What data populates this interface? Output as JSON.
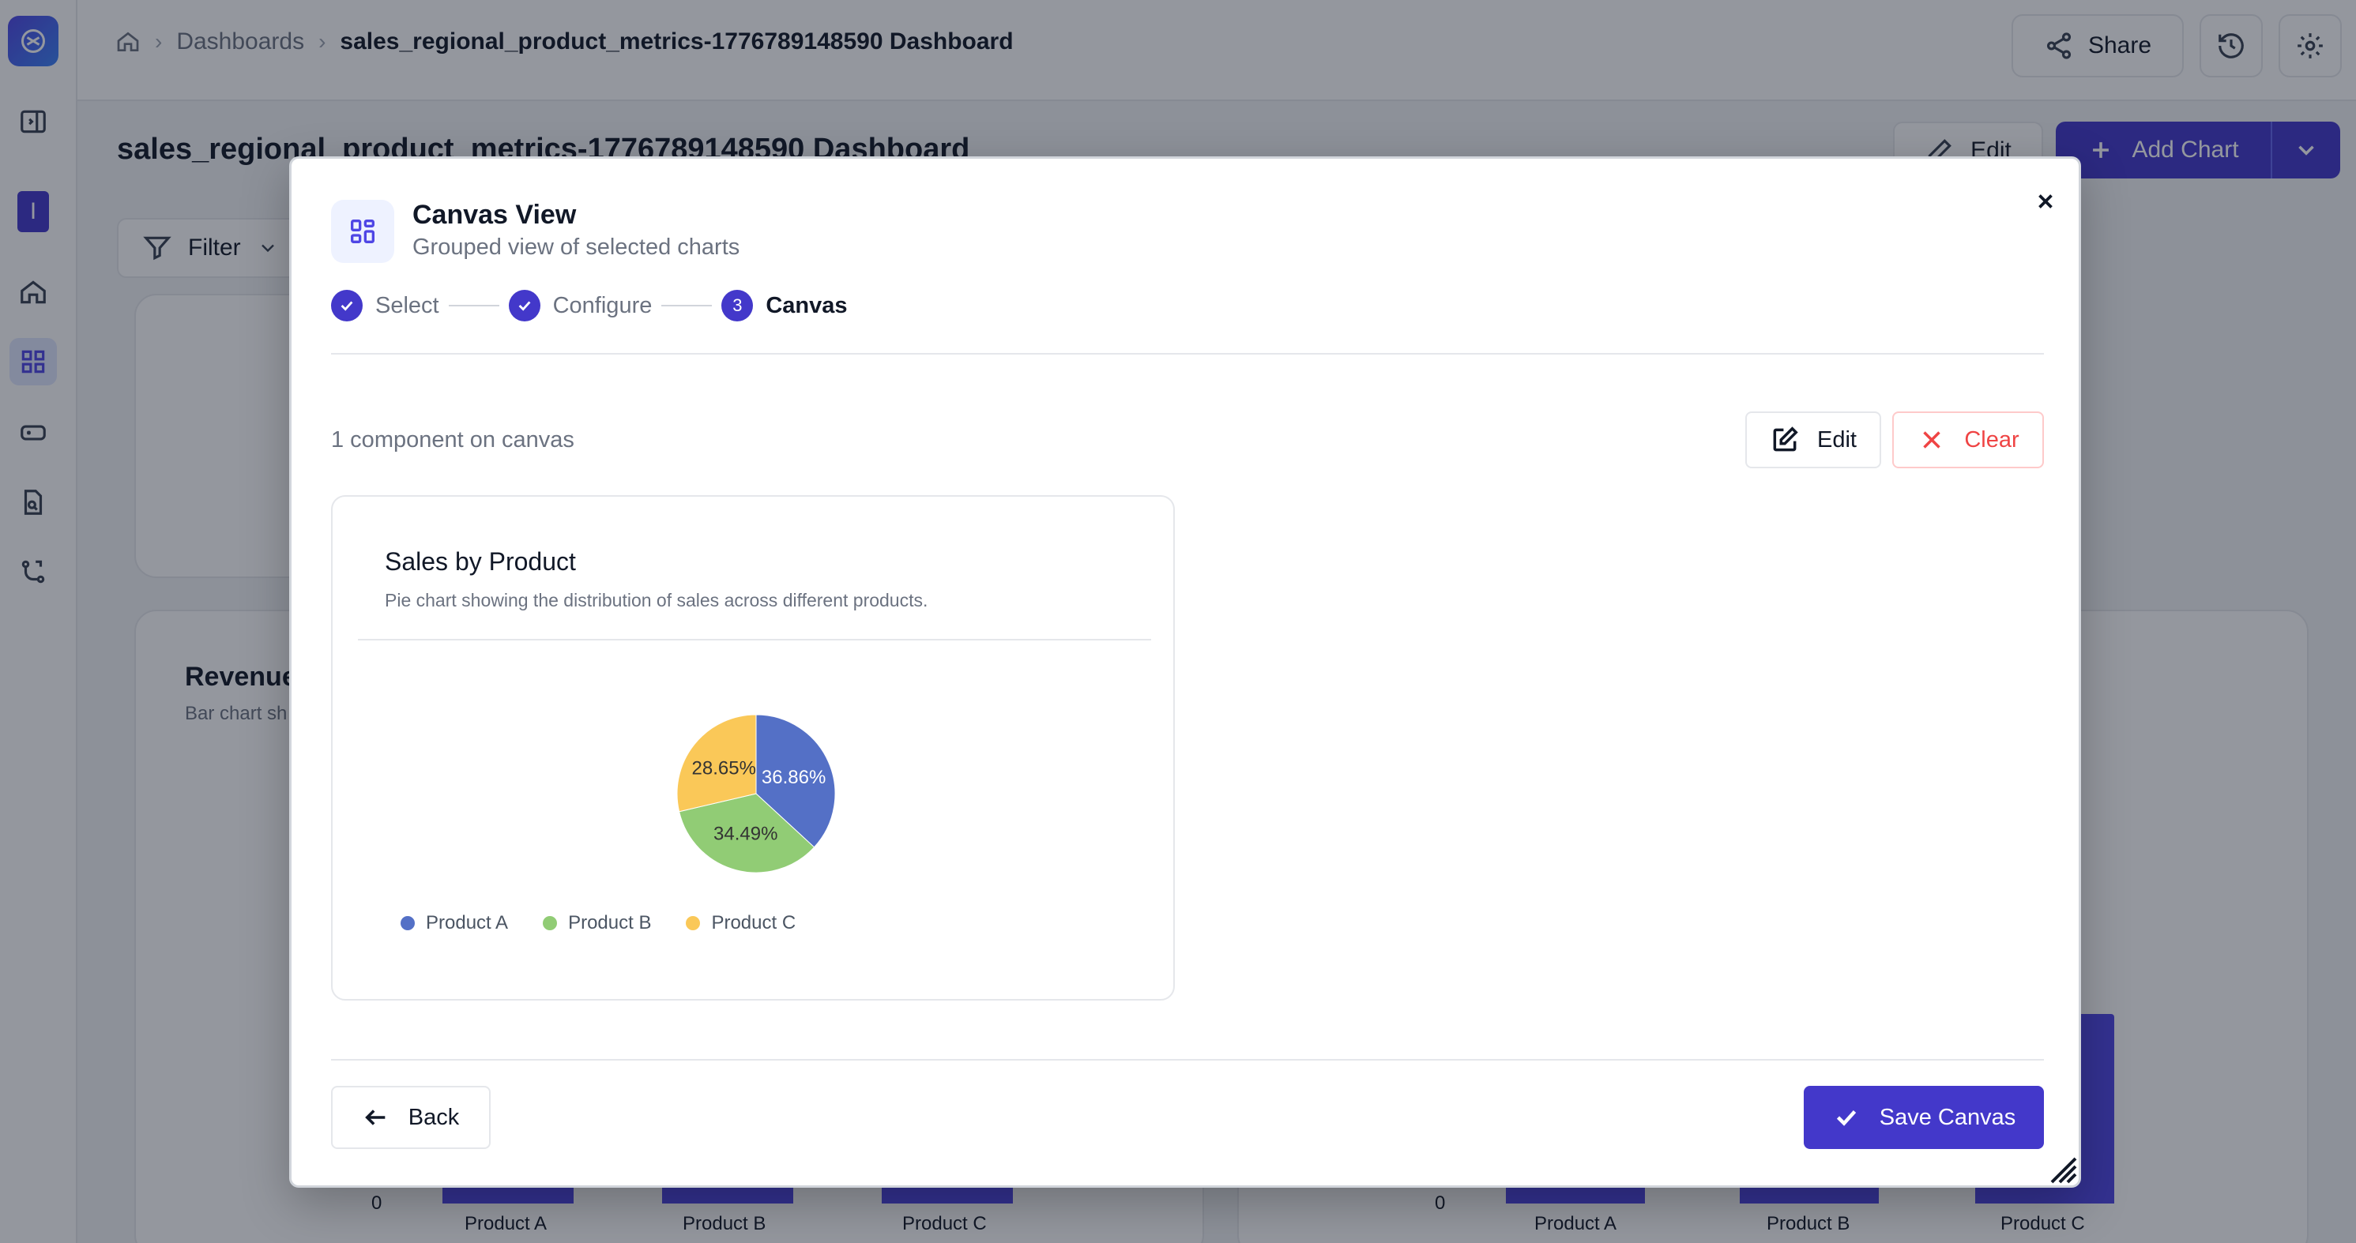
{
  "breadcrumb": {
    "home_icon": "home-icon",
    "items": [
      "Dashboards",
      "sales_regional_product_metrics-1776789148590 Dashboard"
    ]
  },
  "topbar": {
    "share_label": "Share"
  },
  "dashboard": {
    "title": "sales_regional_product_metrics-1776789148590 Dashboard",
    "edit_label": "Edit",
    "add_chart_label": "Add Chart",
    "filter_label": "Filter",
    "bg_chart_title": "Revenue",
    "bg_chart_subtitle": "Bar chart sh",
    "bg_axis_zero": "0",
    "bg_axis_zero_right": "0",
    "bg_categories": [
      "Product A",
      "Product B",
      "Product C"
    ]
  },
  "modal": {
    "title": "Canvas View",
    "subtitle": "Grouped view of selected charts",
    "steps": [
      {
        "label": "Select",
        "state": "done"
      },
      {
        "label": "Configure",
        "state": "done"
      },
      {
        "label": "Canvas",
        "number": "3",
        "state": "current"
      }
    ],
    "component_count": "1 component on canvas",
    "edit_label": "Edit",
    "clear_label": "Clear",
    "back_label": "Back",
    "save_label": "Save Canvas"
  },
  "chart_card": {
    "title": "Sales by Product",
    "subtitle": "Pie chart showing the distribution of sales across different products."
  },
  "chart_data": {
    "type": "pie",
    "title": "Sales by Product",
    "categories": [
      "Product A",
      "Product B",
      "Product C"
    ],
    "values": [
      36.86,
      34.49,
      28.65
    ],
    "labels": [
      "36.86%",
      "34.49%",
      "28.65%"
    ],
    "colors": [
      "#5470c6",
      "#91cc75",
      "#fac858"
    ],
    "legend_position": "bottom"
  },
  "colors": {
    "accent": "#4338ca",
    "danger": "#ef4444"
  }
}
